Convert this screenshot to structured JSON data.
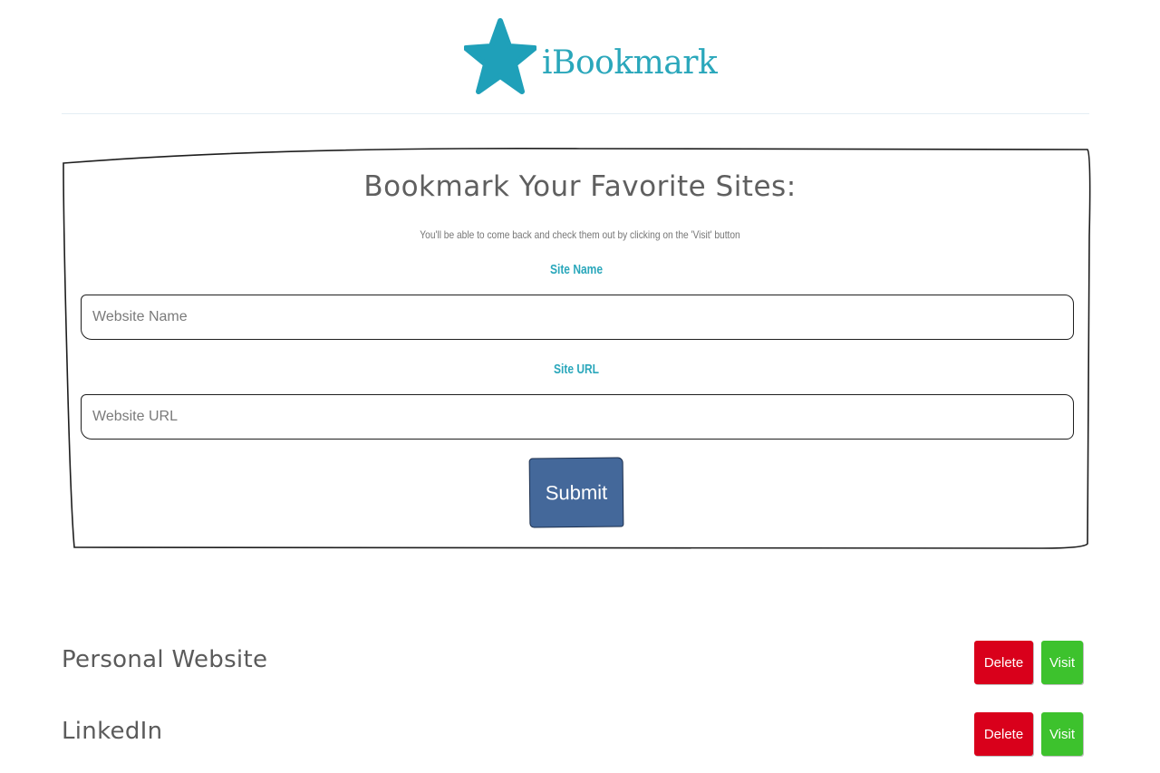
{
  "app": {
    "logo_text": "iBookmark",
    "logo_icon": "star-icon",
    "accent_color": "#2aa7bb"
  },
  "form": {
    "title": "Bookmark Your Favorite Sites:",
    "subtitle": "You'll be able to come back and check them out by clicking on the 'Visit' button",
    "site_name_label": "Site Name",
    "site_name_placeholder": "Website Name",
    "site_url_label": "Site URL",
    "site_url_placeholder": "Website URL",
    "submit_label": "Submit",
    "submit_color": "#44689a"
  },
  "bookmarks": [
    {
      "name": "Personal Website",
      "delete_label": "Delete",
      "visit_label": "Visit"
    },
    {
      "name": "LinkedIn",
      "delete_label": "Delete",
      "visit_label": "Visit"
    }
  ],
  "colors": {
    "delete": "#d9001b",
    "visit": "#3dc22d"
  }
}
